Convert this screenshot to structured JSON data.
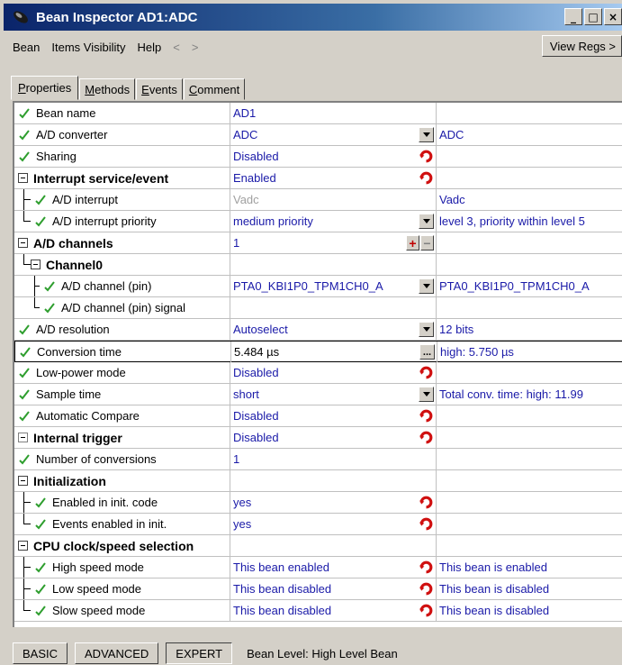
{
  "window": {
    "title": "Bean Inspector AD1:ADC",
    "min": "_",
    "max": "□",
    "close": "×"
  },
  "menu": {
    "items": [
      "Bean",
      "Items Visibility",
      "Help"
    ],
    "back": "<",
    "forward": ">",
    "view_regs": "View Regs >"
  },
  "tabs": [
    {
      "label": "Properties",
      "key": "P",
      "rest": "roperties"
    },
    {
      "label": "Methods",
      "key": "M",
      "rest": "ethods"
    },
    {
      "label": "Events",
      "key": "E",
      "rest": "vents"
    },
    {
      "label": "Comment",
      "key": "C",
      "rest": "omment"
    }
  ],
  "rows": [
    {
      "name": "Bean name",
      "value": "AD1",
      "extra": ""
    },
    {
      "name": "A/D converter",
      "value": "ADC",
      "extra": "ADC"
    },
    {
      "name": "Sharing",
      "value": "Disabled",
      "extra": ""
    },
    {
      "name": "Interrupt service/event",
      "value": "Enabled",
      "extra": ""
    },
    {
      "name": "A/D interrupt",
      "value": "Vadc",
      "extra": "Vadc"
    },
    {
      "name": "A/D interrupt priority",
      "value": "medium priority",
      "extra": "level 3, priority within level 5"
    },
    {
      "name": "A/D channels",
      "value": "1",
      "extra": ""
    },
    {
      "name": "Channel0",
      "value": "",
      "extra": ""
    },
    {
      "name": "A/D channel (pin)",
      "value": "PTA0_KBI1P0_TPM1CH0_A",
      "extra": "PTA0_KBI1P0_TPM1CH0_A"
    },
    {
      "name": "A/D channel (pin) signal",
      "value": "",
      "extra": ""
    },
    {
      "name": "A/D resolution",
      "value": "Autoselect",
      "extra": "12 bits"
    },
    {
      "name": "Conversion time",
      "value": "5.484 µs",
      "extra": "high: 5.750 µs"
    },
    {
      "name": "Low-power mode",
      "value": "Disabled",
      "extra": ""
    },
    {
      "name": "Sample time",
      "value": "short",
      "extra": "Total conv. time: high: 11.99"
    },
    {
      "name": "Automatic Compare",
      "value": "Disabled",
      "extra": ""
    },
    {
      "name": "Internal trigger",
      "value": "Disabled",
      "extra": ""
    },
    {
      "name": "Number of conversions",
      "value": "1",
      "extra": ""
    },
    {
      "name": "Initialization",
      "value": "",
      "extra": ""
    },
    {
      "name": "Enabled in init. code",
      "value": "yes",
      "extra": ""
    },
    {
      "name": "Events enabled in init.",
      "value": "yes",
      "extra": ""
    },
    {
      "name": "CPU clock/speed selection",
      "value": "",
      "extra": ""
    },
    {
      "name": "High speed mode",
      "value": "This bean enabled",
      "extra": "This bean is enabled"
    },
    {
      "name": "Low speed mode",
      "value": "This bean disabled",
      "extra": "This bean is disabled"
    },
    {
      "name": "Slow speed mode",
      "value": "This bean disabled",
      "extra": "This bean is disabled"
    }
  ],
  "controls": {
    "ellipsis": "...",
    "plus": "+",
    "minus": "−"
  },
  "status": {
    "basic": "BASIC",
    "advanced": "ADVANCED",
    "expert": "EXPERT",
    "level": "Bean Level: High Level Bean"
  },
  "colors": {
    "value_text": "#1a1aa8",
    "check": "#2e9e2e",
    "cycle": "#d01010",
    "title_start": "#0a246a"
  }
}
